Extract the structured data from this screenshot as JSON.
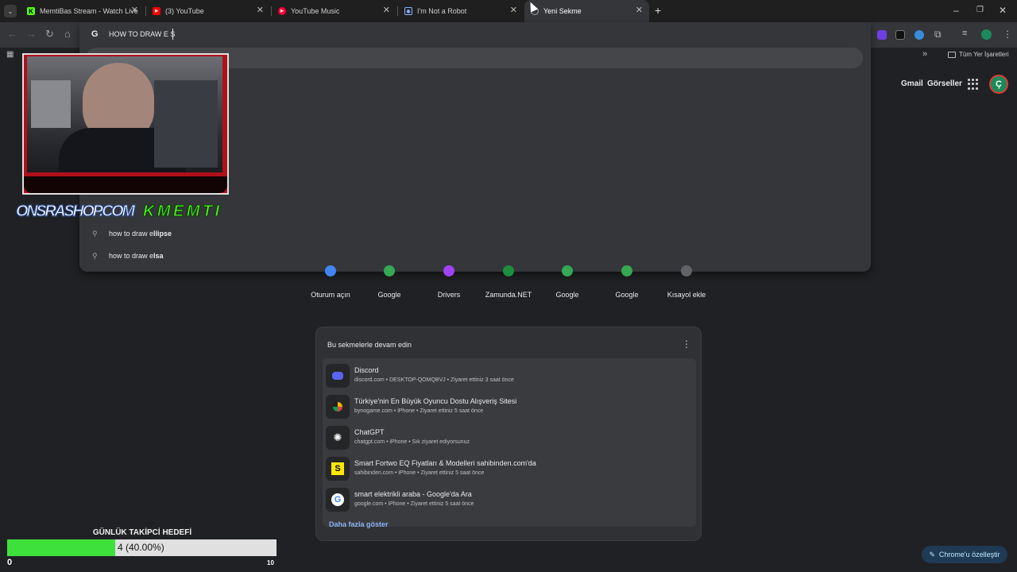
{
  "tabs": [
    {
      "title": "MemtiBas Stream - Watch Live"
    },
    {
      "title": "(3) YouTube"
    },
    {
      "title": "YouTube Music"
    },
    {
      "title": "I'm Not a Robot"
    },
    {
      "title": "Yeni Sekme"
    }
  ],
  "toolbar": {
    "omnibox_text": "HOW TO DRAW E S"
  },
  "bookmarks": {
    "overflow": "»",
    "all_bookmarks": "Tüm Yer İşaretleri"
  },
  "suggestions": [
    {
      "prefix": "how to draw e",
      "completion": "llipse"
    },
    {
      "prefix": "how to draw e",
      "completion": "lsa"
    }
  ],
  "header": {
    "gmail": "Gmail",
    "images": "Görseller",
    "profile_initial": "Ç"
  },
  "shortcuts": [
    {
      "label": "Oturum açın",
      "color": "#4285f4"
    },
    {
      "label": "Google",
      "color": "#34a853"
    },
    {
      "label": "Drivers",
      "color": "#a142f4"
    },
    {
      "label": "Zamunda.NET",
      "color": "#1e8e3e"
    },
    {
      "label": "Google",
      "color": "#34a853"
    },
    {
      "label": "Google",
      "color": "#34a853"
    },
    {
      "label": "Kısayol ekle",
      "color": "#5f6368"
    }
  ],
  "continue_card": {
    "title": "Bu sekmelerle devam edin",
    "items": [
      {
        "title": "Discord",
        "subtitle": "discord.com • DESKTOP-QOMQBVJ • Ziyaret ettiniz 3 saat önce",
        "icon": "discord-icon"
      },
      {
        "title": "Türkiye'nin En Büyük Oyuncu Dostu Alışveriş Sitesi",
        "subtitle": "bynogame.com • iPhone • Ziyaret ettiniz 5 saat önce",
        "icon": "bynogame-icon"
      },
      {
        "title": "ChatGPT",
        "subtitle": "chatgpt.com • iPhone • Sık ziyaret ediyorsunuz",
        "icon": "chatgpt-icon"
      },
      {
        "title": "Smart Fortwo EQ Fiyatları & Modelleri sahibinden.com'da",
        "subtitle": "sahibinden.com • iPhone • Ziyaret ettiniz 5 saat önce",
        "icon": "sahibinden-icon"
      },
      {
        "title": "smart elektrikli araba - Google'da Ara",
        "subtitle": "google.com • iPhone • Ziyaret ettiniz 5 saat önce",
        "icon": "google-icon"
      }
    ],
    "more": "Daha fazla göster"
  },
  "customize": {
    "label": "Chrome'u özelleştir"
  },
  "stream_overlay": {
    "logo_text": "ONSRASHOP.COM",
    "logo_brand": "KMEMTI",
    "goal_title": "GÜNLÜK TAKİPCİ HEDEFİ",
    "goal_current": "4 (40.00%)",
    "goal_progress": 0.4,
    "goal_min": "0",
    "goal_max": "10"
  }
}
